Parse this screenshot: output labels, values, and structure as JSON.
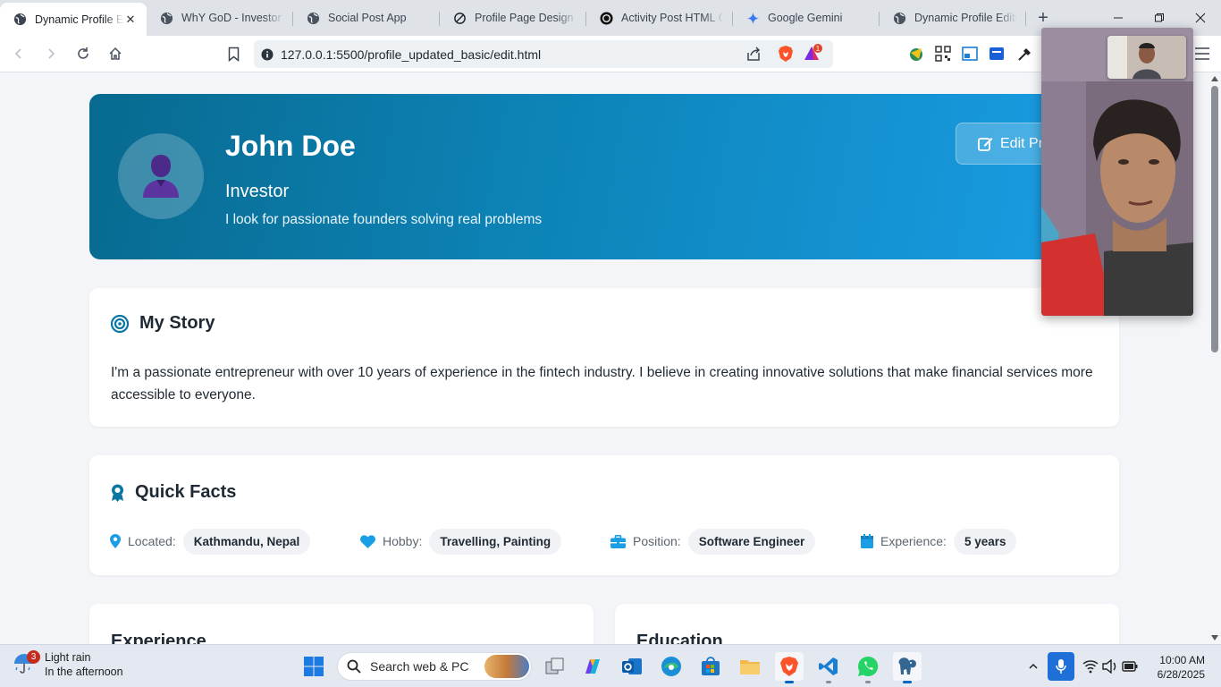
{
  "browser": {
    "tabs": [
      {
        "title": "Dynamic Profile E",
        "active": true,
        "icon": "globe-icon"
      },
      {
        "title": "WhY GoD - Investor P",
        "active": false,
        "icon": "globe-icon"
      },
      {
        "title": "Social Post App",
        "active": false,
        "icon": "globe-icon"
      },
      {
        "title": "Profile Page Design ar",
        "active": false,
        "icon": "chatgpt-icon"
      },
      {
        "title": "Activity Post HTML Co",
        "active": false,
        "icon": "openai-icon"
      },
      {
        "title": "Google Gemini",
        "active": false,
        "icon": "gemini-icon"
      },
      {
        "title": "Dynamic Profile Edito",
        "active": false,
        "icon": "globe-icon"
      }
    ],
    "url": "127.0.0.1:5500/profile_updated_basic/edit.html",
    "rewards_count": "1"
  },
  "profile": {
    "name": "John Doe",
    "role": "Investor",
    "bio": "I look for passionate founders solving real problems",
    "edit_label": "Edit Pr"
  },
  "story": {
    "heading": "My Story",
    "text": "I'm a passionate entrepreneur with over 10 years of experience in the fintech industry. I believe in creating innovative solutions that make financial services more accessible to everyone."
  },
  "facts": {
    "heading": "Quick Facts",
    "items": [
      {
        "label": "Located:",
        "value": "Kathmandu, Nepal",
        "icon": "map-pin-icon"
      },
      {
        "label": "Hobby:",
        "value": "Travelling, Painting",
        "icon": "heart-icon"
      },
      {
        "label": "Position:",
        "value": "Software Engineer",
        "icon": "briefcase-icon"
      },
      {
        "label": "Experience:",
        "value": "5 years",
        "icon": "calendar-icon"
      }
    ]
  },
  "sections": {
    "experience": "Experience",
    "education": "Education"
  },
  "taskbar": {
    "weather_title": "Light rain",
    "weather_sub": "In the afternoon",
    "weather_badge": "3",
    "search_placeholder": "Search web & PC",
    "time": "10:00 AM",
    "date": "6/28/2025"
  },
  "colors": {
    "hero_start": "#086a8f",
    "hero_end": "#1a9ee6",
    "accent": "#0b76a3",
    "fact_icon": "#1a9ee6"
  }
}
